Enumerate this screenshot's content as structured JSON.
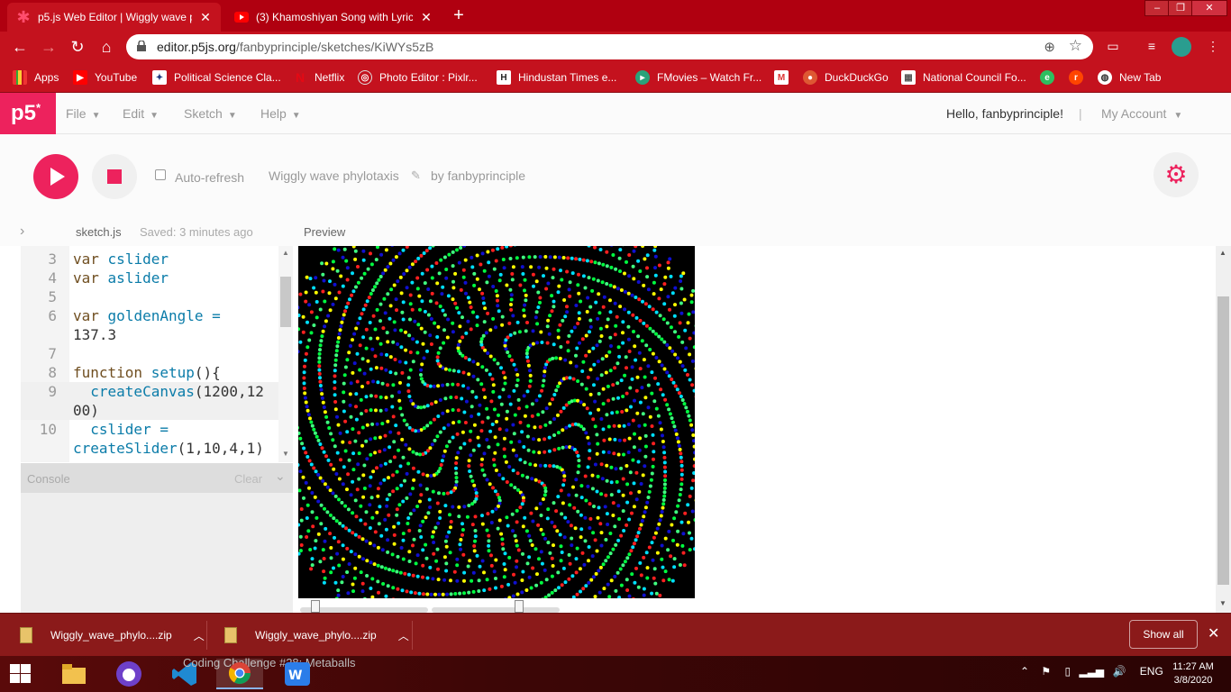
{
  "browser": {
    "tabs": [
      {
        "title": "p5.js Web Editor | Wiggly wave ph",
        "icon": "p5-asterisk-icon",
        "active": true
      },
      {
        "title": "(3) Khamoshiyan Song with Lyric",
        "icon": "youtube-icon",
        "active": false
      }
    ],
    "new_tab": "+",
    "window_controls": [
      "–",
      "❐",
      "✕"
    ],
    "url_host": "editor.p5js.org",
    "url_path": "/fanbyprinciple/sketches/KiWYs5zB",
    "bookmarks": [
      {
        "label": "Apps",
        "icon": "apps-grid-icon"
      },
      {
        "label": "YouTube",
        "icon": "youtube-icon"
      },
      {
        "label": "Political Science Cla...",
        "icon": "bookmark-site-icon"
      },
      {
        "label": "Netflix",
        "icon": "netflix-icon"
      },
      {
        "label": "Photo Editor : Pixlr...",
        "icon": "pixlr-icon"
      },
      {
        "label": "Hindustan Times e...",
        "icon": "hindustan-times-icon"
      },
      {
        "label": "FMovies – Watch Fr...",
        "icon": "fmovies-icon"
      },
      {
        "label": "",
        "icon": "gmail-icon"
      },
      {
        "label": "DuckDuckGo",
        "icon": "duckduckgo-icon"
      },
      {
        "label": "National Council Fo...",
        "icon": "ncert-icon"
      },
      {
        "label": "",
        "icon": "evernote-icon"
      },
      {
        "label": "",
        "icon": "reddit-icon"
      },
      {
        "label": "New Tab",
        "icon": "globe-icon"
      }
    ]
  },
  "p5": {
    "logo": "p5",
    "logo_sup": "*",
    "menus": [
      "File",
      "Edit",
      "Sketch",
      "Help"
    ],
    "greeting": "Hello, fanbyprinciple!",
    "separator": "|",
    "account": "My Account",
    "auto_refresh": "Auto-refresh",
    "sketch_name": "Wiggly wave phylotaxis",
    "byline": "by fanbyprinciple",
    "file_name": "sketch.js",
    "saved": "Saved: 3 minutes ago",
    "preview_label": "Preview",
    "console_label": "Console",
    "console_clear": "Clear",
    "code_lines": [
      {
        "n": "3",
        "text": "var cslider"
      },
      {
        "n": "4",
        "text": "var aslider"
      },
      {
        "n": "5",
        "text": ""
      },
      {
        "n": "6",
        "text": "var goldenAngle ="
      },
      {
        "n": "",
        "text": "137.3"
      },
      {
        "n": "7",
        "text": ""
      },
      {
        "n": "8",
        "text": "function setup(){"
      },
      {
        "n": "9",
        "text": "  createCanvas(1200,12"
      },
      {
        "n": "",
        "text": "00)"
      },
      {
        "n": "10",
        "text": "  cslider ="
      },
      {
        "n": "",
        "text": "createSlider(1,10,4,1)"
      }
    ],
    "slider_c_value": 0.12,
    "slider_a_value": 0.68
  },
  "downloads": {
    "items": [
      "Wiggly_wave_phylo....zip",
      "Wiggly_wave_phylo....zip"
    ],
    "show_all": "Show all"
  },
  "taskbar": {
    "window_title": "Coding Challenge #28: Metaballs",
    "language": "ENG",
    "time": "11:27 AM",
    "date": "3/8/2020"
  },
  "colors": {
    "accent": "#ed225d",
    "chrome_red": "#c4121e",
    "dot_palette": [
      "#ffff00",
      "#00e0ff",
      "#00ff40",
      "#1010d0",
      "#ff2020",
      "#40ff80"
    ]
  }
}
